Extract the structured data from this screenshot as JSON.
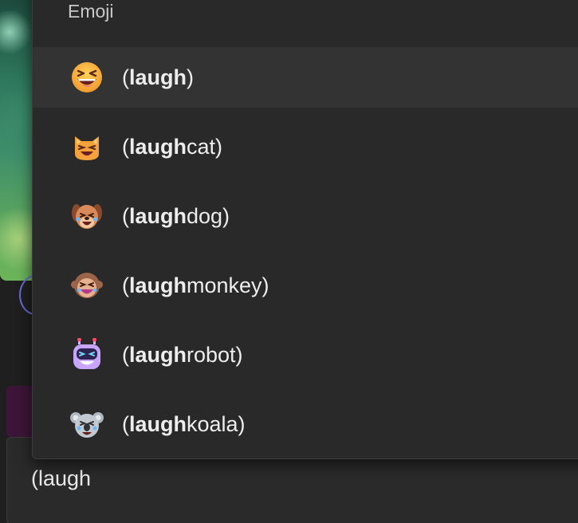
{
  "popup": {
    "header": "Emoji"
  },
  "emoji_list": [
    {
      "label_open": "(",
      "match": "laugh",
      "suffix": ")",
      "icon": "laughing-face-emoji",
      "selected": true
    },
    {
      "label_open": "(",
      "match": "laugh",
      "suffix": "cat)",
      "icon": "laughing-cat-emoji",
      "selected": false
    },
    {
      "label_open": "(",
      "match": "laugh",
      "suffix": "dog)",
      "icon": "laughing-dog-emoji",
      "selected": false
    },
    {
      "label_open": "(",
      "match": "laugh",
      "suffix": "monkey)",
      "icon": "laughing-monkey-emoji",
      "selected": false
    },
    {
      "label_open": "(",
      "match": "laugh",
      "suffix": "robot)",
      "icon": "laughing-robot-emoji",
      "selected": false
    },
    {
      "label_open": "(",
      "match": "laugh",
      "suffix": "koala)",
      "icon": "laughing-koala-emoji",
      "selected": false
    }
  ],
  "compose": {
    "text": "(laugh"
  },
  "colors": {
    "popup_bg": "#292929",
    "selected_bg": "#333333",
    "text": "#ededed"
  }
}
